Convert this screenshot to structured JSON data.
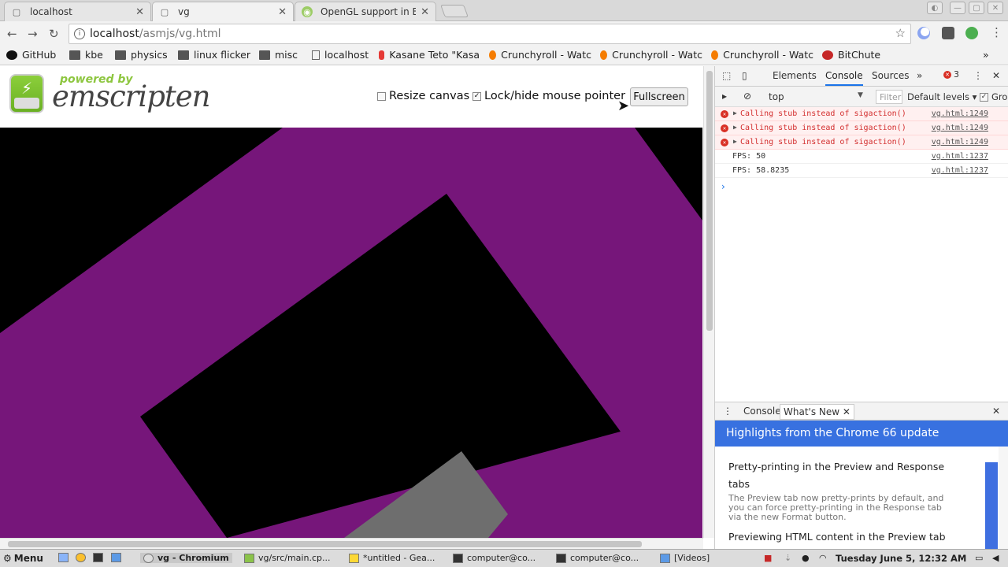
{
  "tabs": [
    {
      "title": "localhost",
      "active": false
    },
    {
      "title": "vg",
      "active": true
    },
    {
      "title": "OpenGL support in En",
      "active": false
    }
  ],
  "toolbar": {
    "url_host": "localhost",
    "url_path": "/asmjs/vg.html"
  },
  "bookmarks": [
    "GitHub",
    "kbe",
    "physics",
    "linux flicker",
    "misc",
    "localhost",
    "Kasane Teto \"Kasa",
    "Crunchyroll - Watc",
    "Crunchyroll - Watc",
    "Crunchyroll - Watc",
    "BitChute"
  ],
  "page": {
    "powered_by": "powered by",
    "brand": "emscripten",
    "resize_label": "Resize canvas",
    "lock_label": "Lock/hide mouse pointer",
    "resize_checked": false,
    "lock_checked": true,
    "fullscreen_label": "Fullscreen",
    "colors": {
      "purple": "#76167a",
      "gray": "#6e6e6e",
      "background": "#000000"
    }
  },
  "devtools": {
    "tabs": [
      "Elements",
      "Console",
      "Sources"
    ],
    "active_tab": "Console",
    "error_count": "3",
    "context": "top",
    "filter_placeholder": "Filter",
    "levels": "Default levels",
    "group_label": "Gro",
    "messages": [
      {
        "type": "error",
        "text": "Calling stub instead of sigaction()",
        "source": "vg.html:1249"
      },
      {
        "type": "error",
        "text": "Calling stub instead of sigaction()",
        "source": "vg.html:1249"
      },
      {
        "type": "error",
        "text": "Calling stub instead of sigaction()",
        "source": "vg.html:1249"
      },
      {
        "type": "log",
        "text": "FPS: 50",
        "source": "vg.html:1237"
      },
      {
        "type": "log",
        "text": "FPS: 58.8235",
        "source": "vg.html:1237"
      }
    ],
    "drawer_tabs": [
      "Console",
      "What's New"
    ],
    "whats_new": {
      "header": "Highlights from the Chrome 66 update",
      "item1_title": "Pretty-printing in the Preview and Response tabs",
      "item1_body": "The Preview tab now pretty-prints by default, and you can force pretty-printing in the Response tab via the new Format button.",
      "item2_title": "Previewing HTML content in the Preview tab"
    }
  },
  "taskbar": {
    "menu": "Menu",
    "items": [
      "vg - Chromium",
      "vg/src/main.cp...",
      "*untitled - Gea...",
      "computer@co...",
      "computer@co...",
      "[Videos]"
    ],
    "clock": "Tuesday June  5, 12:32 AM"
  }
}
